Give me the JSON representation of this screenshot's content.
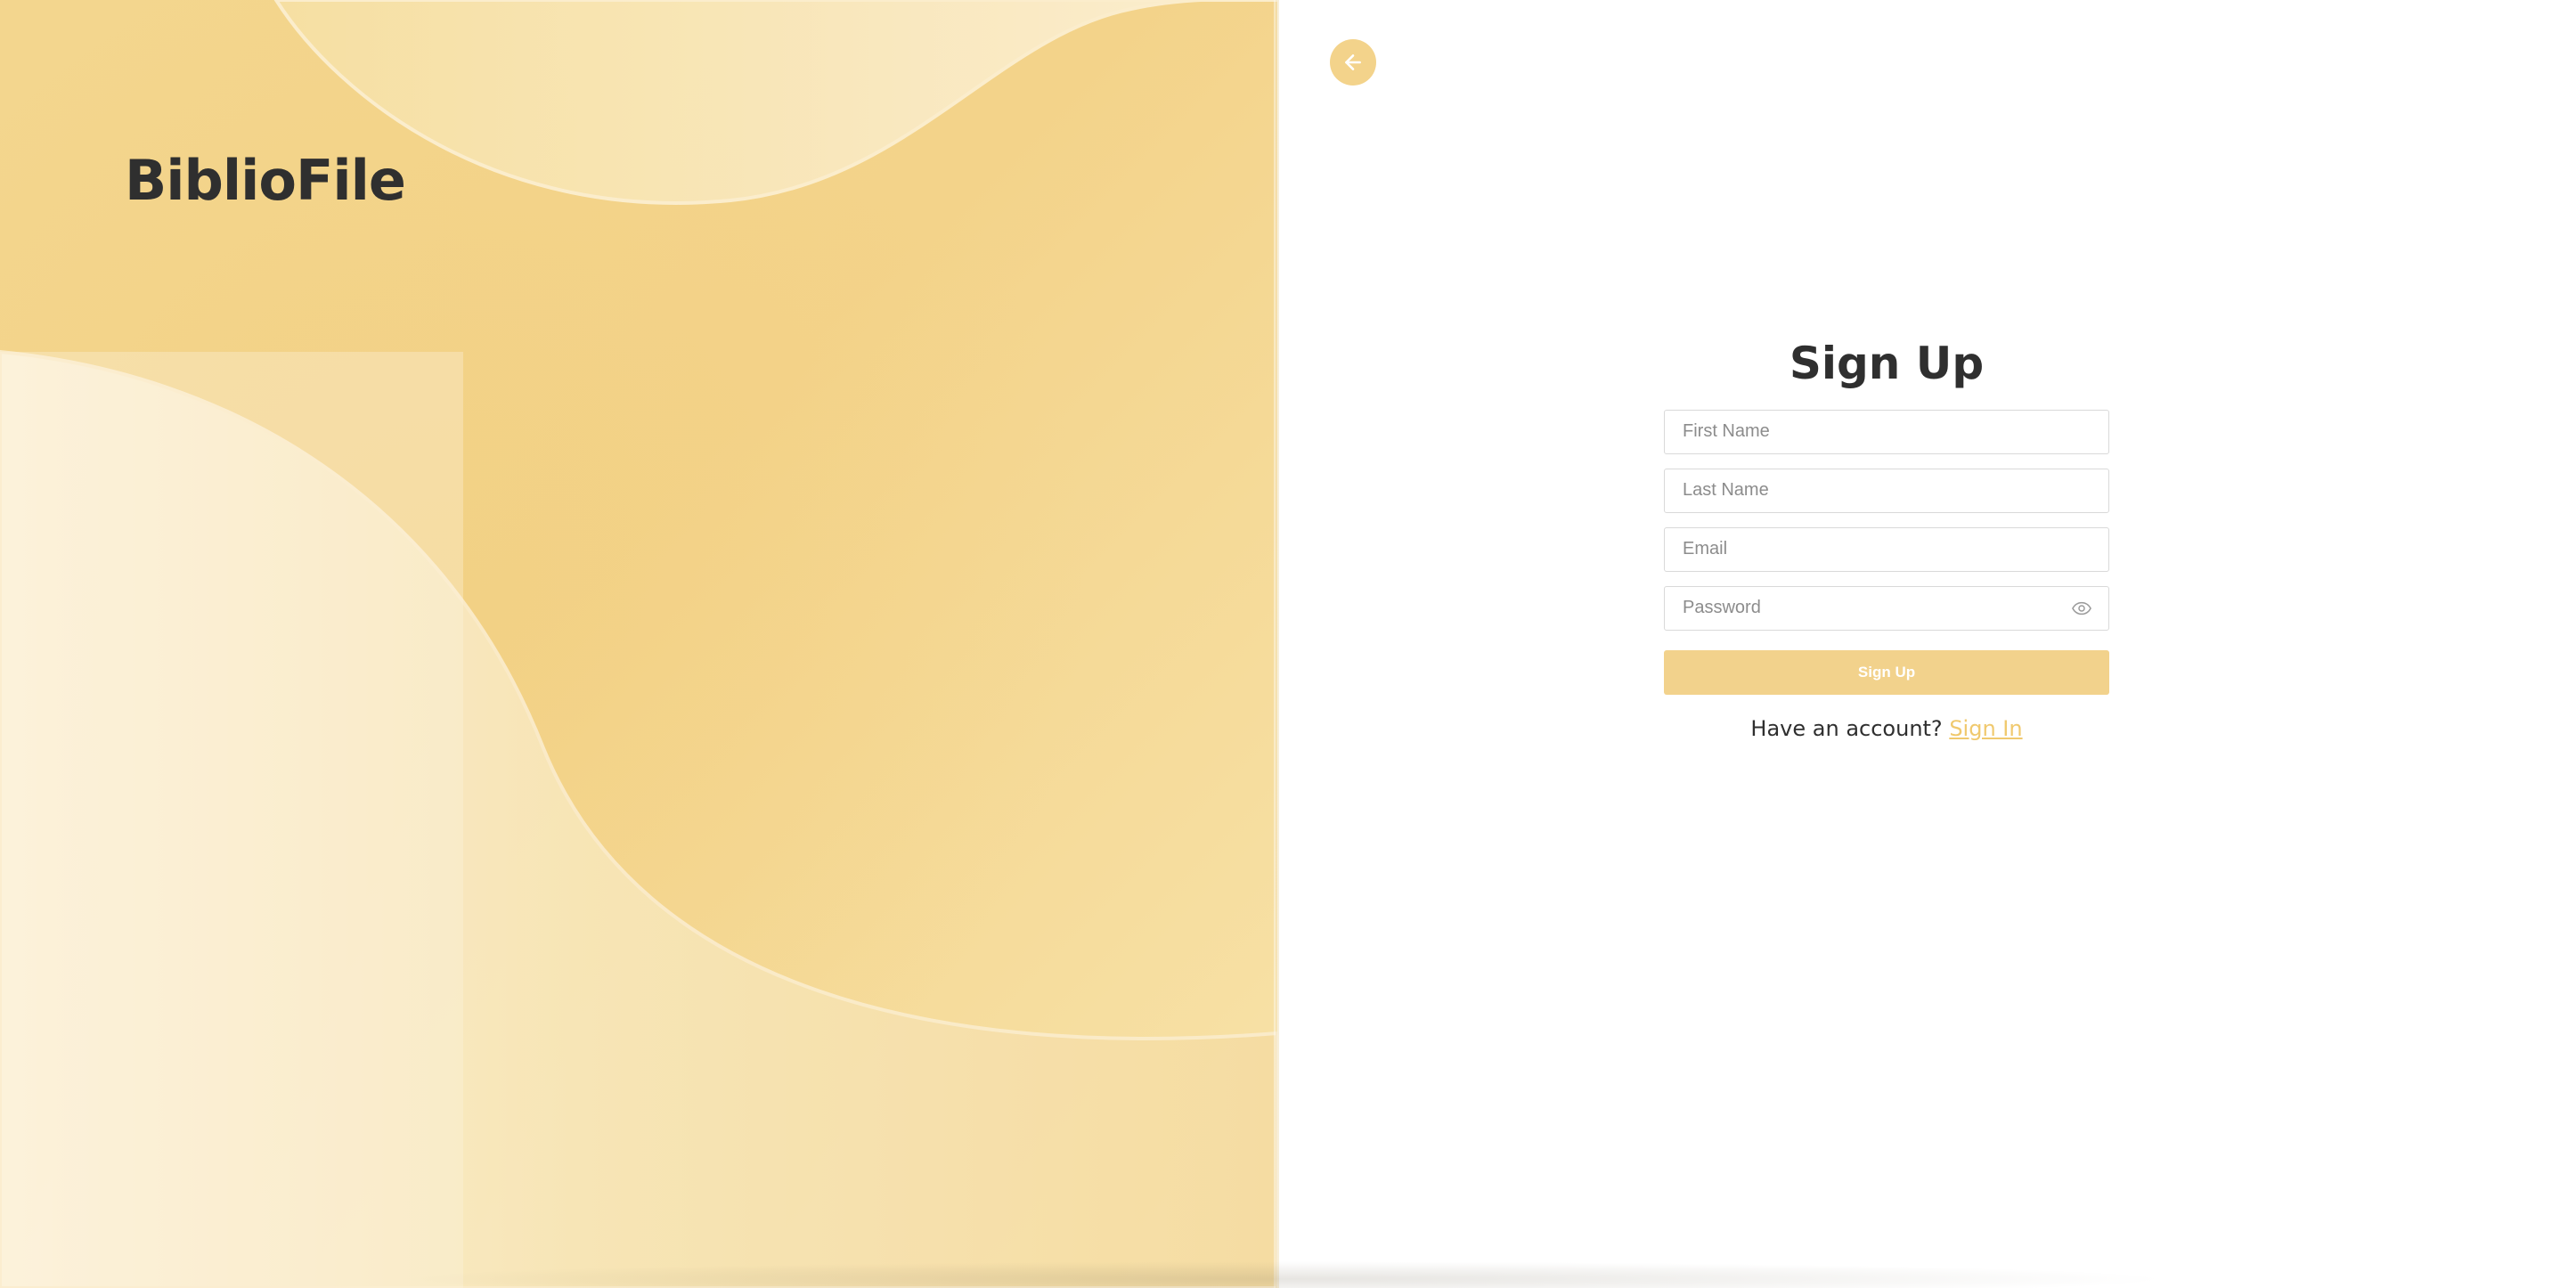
{
  "brand": {
    "name": "BiblioFile"
  },
  "colors": {
    "accent": "#f2d28c",
    "panel_base": "#f5dc9c",
    "panel_light": "#fbecc7",
    "text_dark": "#2f2f2f",
    "link": "#f0c96e"
  },
  "icons": {
    "back": "arrow-left-icon",
    "password_toggle": "eye-icon"
  },
  "form": {
    "title": "Sign Up",
    "fields": {
      "first_name": {
        "placeholder": "First Name",
        "value": ""
      },
      "last_name": {
        "placeholder": "Last Name",
        "value": ""
      },
      "email": {
        "placeholder": "Email",
        "value": ""
      },
      "password": {
        "placeholder": "Password",
        "value": ""
      }
    },
    "submit_label": "Sign Up",
    "switch_prompt": "Have an account?",
    "switch_link": "Sign In"
  }
}
